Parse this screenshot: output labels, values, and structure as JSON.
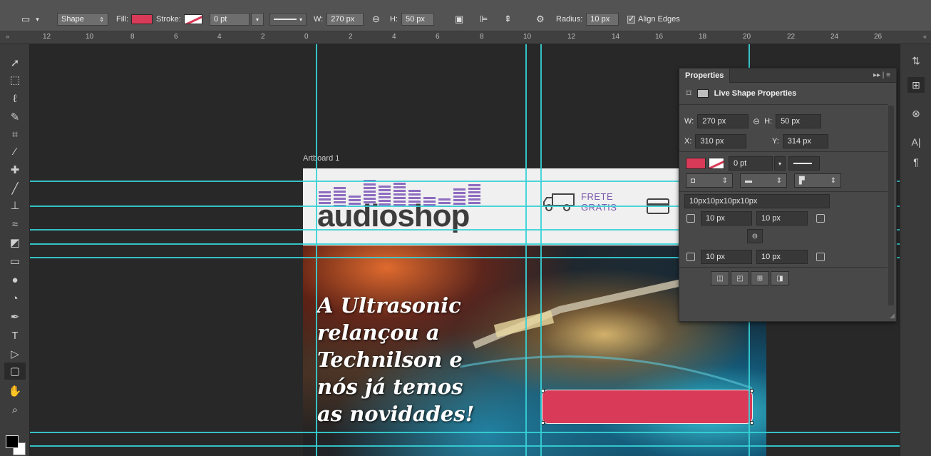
{
  "options_bar": {
    "tool_mode": "Shape",
    "fill_label": "Fill:",
    "stroke_label": "Stroke:",
    "stroke_width": "0 pt",
    "w_label": "W:",
    "width": "270 px",
    "h_label": "H:",
    "height": "50 px",
    "radius_label": "Radius:",
    "radius": "10 px",
    "align_edges": "Align Edges"
  },
  "ruler": {
    "labels": [
      "12",
      "10",
      "8",
      "6",
      "4",
      "2",
      "0",
      "2",
      "4",
      "6",
      "8",
      "10",
      "12",
      "14",
      "16",
      "18",
      "20",
      "22",
      "24",
      "26"
    ]
  },
  "artboard": {
    "label": "Artboard 1",
    "logo": "audioshop",
    "frete_line1": "FRETE",
    "frete_line2": "GRATIS",
    "hero_line1": "A Ultrasonic",
    "hero_line2": "relançou a",
    "hero_line3": "Technilson e",
    "hero_line4": "nós já temos",
    "hero_line5": "as novidades!"
  },
  "properties": {
    "tab": "Properties",
    "section_title": "Live Shape Properties",
    "w_label": "W:",
    "w": "270 px",
    "h_label": "H:",
    "h": "50 px",
    "x_label": "X:",
    "x": "310 px",
    "y_label": "Y:",
    "y": "314 px",
    "stroke_width": "0 pt",
    "corner_summary": "10px10px10px10px",
    "corner_tl": "10 px",
    "corner_tr": "10 px",
    "corner_bl": "10 px",
    "corner_br": "10 px"
  },
  "colors": {
    "fill": "#d93a57",
    "guide": "#36d2d6",
    "logo_purple": "#8e6cc0",
    "frete_purple": "#7b59ad"
  }
}
